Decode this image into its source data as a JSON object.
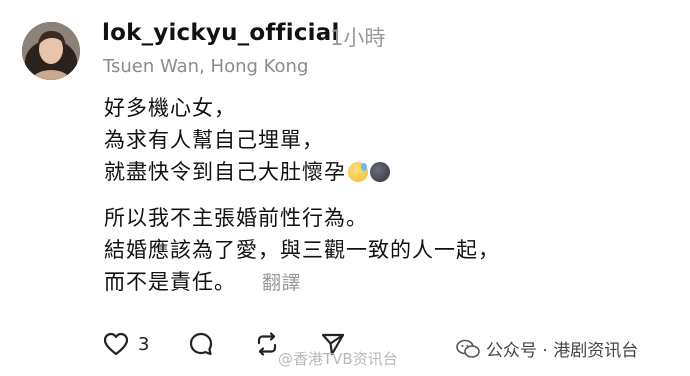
{
  "post": {
    "username": "lok_yickyu_official",
    "time": "1小時",
    "location": "Tsuen Wan, Hong Kong",
    "lines": [
      "好多機心女，",
      "為求有人幫自己埋單，",
      "就盡快令到自己大肚懷孕"
    ],
    "lines2": [
      "所以我不主張婚前性行為。",
      "結婚應該為了愛，與三觀一致的人一起，",
      "而不是責任。"
    ],
    "translate_label": "翻譯",
    "like_count": "3"
  },
  "icons": {
    "avatar": "avatar",
    "like": "heart-icon",
    "comment": "comment-icon",
    "repost": "repost-icon",
    "share": "send-icon",
    "emoji1": "sweat-smile-emoji-icon",
    "emoji2": "new-moon-face-emoji-icon"
  },
  "watermarks": {
    "weibo": "@香港TVB资讯台",
    "wechat": "公众号 · 港剧资讯台"
  }
}
